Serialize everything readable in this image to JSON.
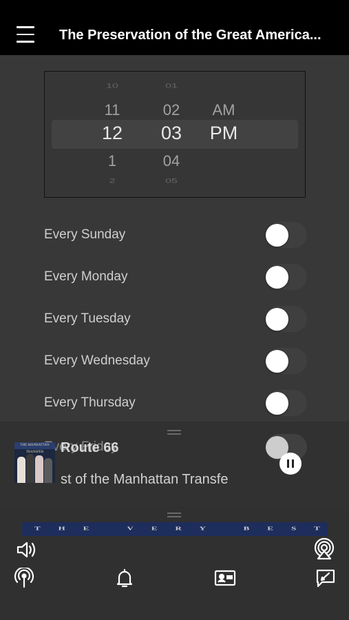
{
  "header": {
    "title": "The Preservation of the Great America..."
  },
  "picker": {
    "hours": [
      "10",
      "11",
      "12",
      "1",
      "2"
    ],
    "minutes": [
      "01",
      "02",
      "03",
      "04",
      "05"
    ],
    "ampm": [
      "AM",
      "PM"
    ]
  },
  "days": [
    {
      "label": "Every Sunday",
      "on": false
    },
    {
      "label": "Every Monday",
      "on": false
    },
    {
      "label": "Every Tuesday",
      "on": false
    },
    {
      "label": "Every Wednesday",
      "on": false
    },
    {
      "label": "Every Thursday",
      "on": false
    },
    {
      "label": "Every Friday",
      "on": false
    }
  ],
  "player": {
    "title": "Route 66",
    "artist_partial": "st of the Manhattan Transfe",
    "album_art_text": "THE MANHATTAN TRANSFER"
  },
  "album_strip": {
    "text": "THE VERY BEST OF"
  },
  "icons": {
    "menu": "hamburger-icon",
    "pause": "pause-icon",
    "volume": "speaker-icon",
    "airplay": "airplay-icon",
    "podcast": "podcast-icon",
    "alarm": "bell-icon",
    "contact": "contact-card-icon",
    "feedback": "compose-icon"
  }
}
